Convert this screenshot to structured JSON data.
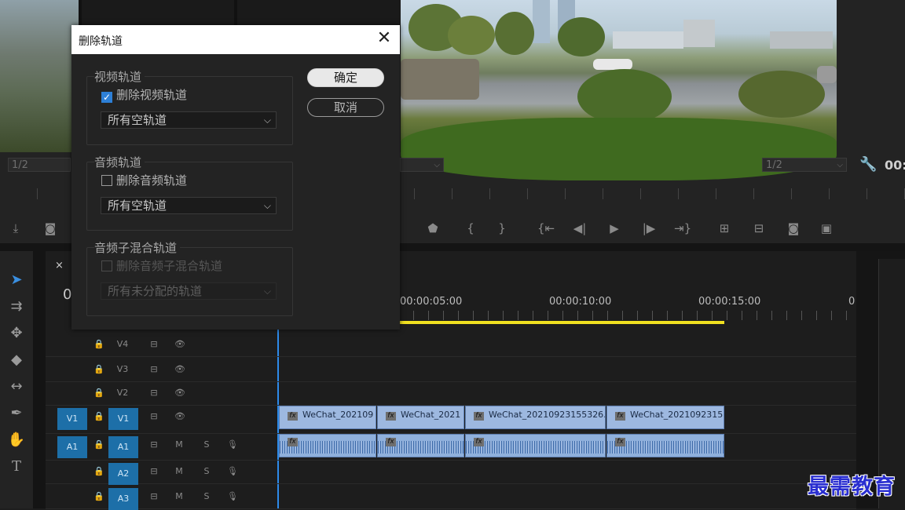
{
  "dialog": {
    "title": "删除轨道",
    "close_label": "✕",
    "ok_label": "确定",
    "cancel_label": "取消",
    "video_group": {
      "title": "视频轨道",
      "checkbox_label": "删除视频轨道",
      "checked": true,
      "select_value": "所有空轨道"
    },
    "audio_group": {
      "title": "音频轨道",
      "checkbox_label": "删除音频轨道",
      "checked": false,
      "select_value": "所有空轨道"
    },
    "submix_group": {
      "title": "音频子混合轨道",
      "checkbox_label": "删除音频子混合轨道",
      "checked": false,
      "select_value": "所有未分配的轨道",
      "disabled": true
    }
  },
  "monitor": {
    "left_res": "1/2",
    "right_res": "1/2",
    "right_timecode": "00:"
  },
  "timeline": {
    "close_tab": "×",
    "timecodes": [
      "00:00:05:00",
      "00:00:10:00",
      "00:00:15:00",
      "0"
    ],
    "left_timecode_fragment": "0",
    "tracks": [
      {
        "name": "V4",
        "src": ""
      },
      {
        "name": "V3",
        "src": ""
      },
      {
        "name": "V2",
        "src": ""
      },
      {
        "name": "V1",
        "src": "V1"
      },
      {
        "name": "A1",
        "src": "A1"
      },
      {
        "name": "A2",
        "src": ""
      },
      {
        "name": "A3",
        "src": ""
      }
    ],
    "audio_mute": "M",
    "audio_solo": "S",
    "clips": [
      "WeChat_202109",
      "WeChat_2021",
      "WeChat_20210923155326.",
      "WeChat_2021092315"
    ],
    "fx_label": "fx"
  },
  "watermark": "最需教育"
}
